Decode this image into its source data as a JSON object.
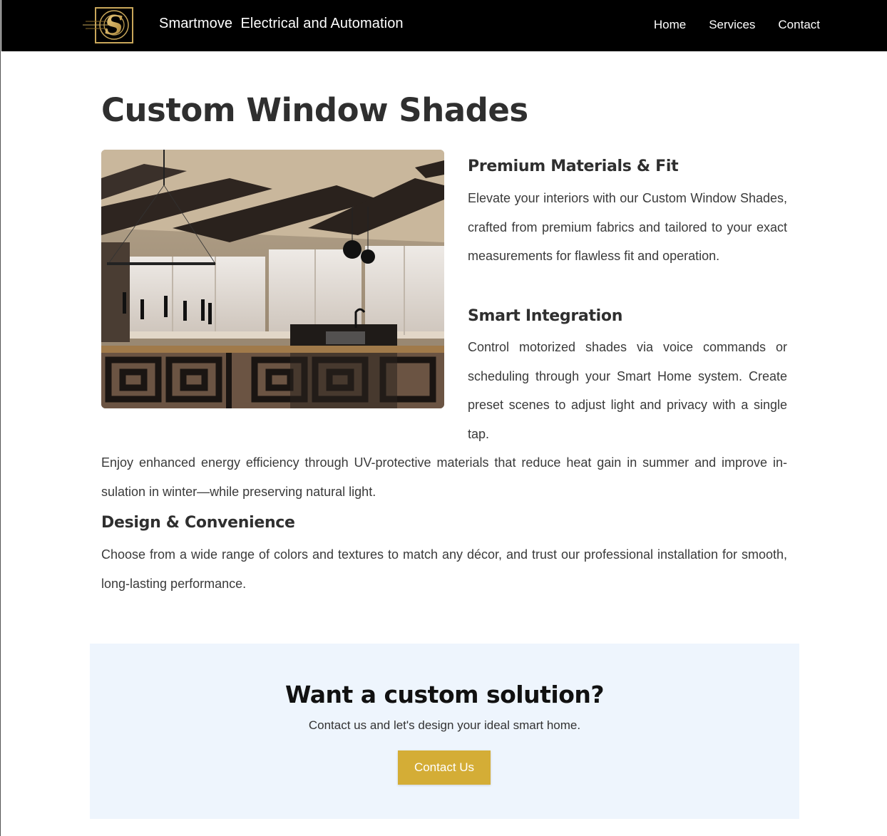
{
  "header": {
    "logo_icon": "smartmove-s-logo-icon",
    "brand_name": "Smartmove  Electrical and Automation",
    "nav": [
      {
        "label": "Home"
      },
      {
        "label": "Services"
      },
      {
        "label": "Contact"
      }
    ]
  },
  "main": {
    "title": "Custom Window Shades",
    "image_alt": "Modern kitchen interior with window shades",
    "sections": [
      {
        "heading": "Premium Materials & Fit",
        "body": "Elevate your interiors with our Custom Window Shades, crafted from premium fabrics and tailored to your exact measurements for flawless fit and operation."
      },
      {
        "heading": "Smart Integration",
        "body": "Control motorized shades via voice commands or scheduling through your Smart Home system. Create preset scenes to adjust light and privacy with a single tap."
      }
    ],
    "energy_text": "Enjoy enhanced energy efficiency through UV-protective materials that reduce heat gain in summer and improve in-sulation in winter—while preserving natural light.",
    "design_heading": "Design & Convenience",
    "design_text": "Choose from a wide range of colors and textures to match any décor, and trust our professional installation for smooth, long-lasting performance."
  },
  "cta": {
    "title": "Want a custom solution?",
    "subtitle": "Contact us and let's design your ideal smart home.",
    "button_label": "Contact Us",
    "button_color": "#d4ad36",
    "background": "#eef5fd"
  }
}
